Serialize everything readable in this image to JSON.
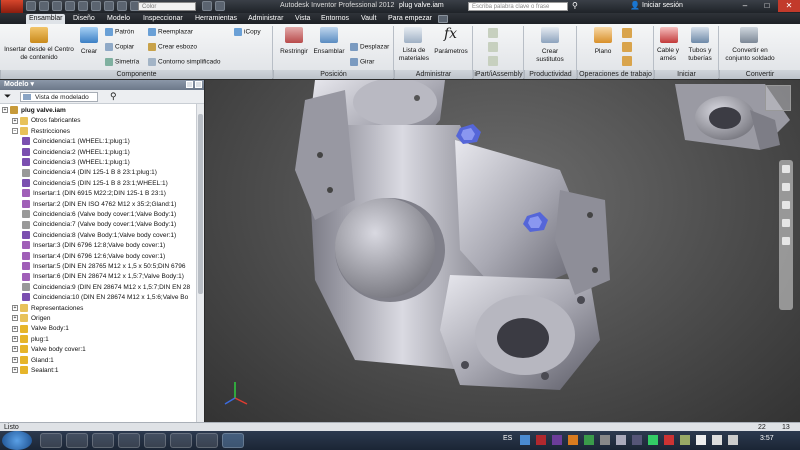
{
  "titlebar": {
    "color_placeholder": "Color",
    "app_title": "Autodesk Inventor Professional 2012",
    "file_name": "plug valve.iam",
    "search_placeholder": "Escriba palabra clave o frase",
    "login": "Iniciar sesión",
    "window_buttons": [
      "–",
      "□",
      "✕"
    ]
  },
  "tabs": [
    "Ensamblar",
    "Diseño",
    "Modelo",
    "Inspeccionar",
    "Herramientas",
    "Administrar",
    "Vista",
    "Entornos",
    "Vault",
    "Para empezar"
  ],
  "ribbon": {
    "componente": {
      "label": "Componente",
      "insert": "Insertar desde el Centro de contenido",
      "crear": "Crear",
      "patron": "Patrón",
      "copiar": "Copiar",
      "simetria": "Simetría",
      "reemplazar": "Reemplazar",
      "crear_esbozo": "Crear esbozo",
      "contorno": "Contorno simplificado",
      "icopy": "iCopy"
    },
    "posicion": {
      "label": "Posición",
      "restringir": "Restringir",
      "ensamblar": "Ensamblar",
      "desplazar": "Desplazar",
      "girar": "Girar"
    },
    "administrar": {
      "label": "Administrar",
      "lista": "Lista de materiales",
      "parametros": "Parámetros"
    },
    "ipart_label": "iPart/iAssembly",
    "productividad": {
      "label": "Productividad",
      "crear_sustitutos": "Crear sustitutos"
    },
    "operaciones": {
      "label": "Operaciones de trabajo",
      "plano": "Plano"
    },
    "iniciar": {
      "label": "Iniciar",
      "cable": "Cable y arnés",
      "tubos": "Tubos y tuberías"
    },
    "convertir": {
      "label": "Convertir",
      "convertir": "Convertir en conjunto soldado"
    }
  },
  "browser": {
    "title": "Modelo ▾",
    "view": "Vista de modelado",
    "tree": [
      {
        "label": "plug valve.iam",
        "level": 0,
        "icon": "assembly-icon",
        "bold": true
      },
      {
        "label": "Otros fabricantes",
        "level": 1,
        "icon": "folder-icon"
      },
      {
        "label": "Restricciones",
        "level": 1,
        "icon": "folder-icon",
        "open": true
      },
      {
        "label": "Coincidencia:1 (WHEEL:1;plug:1)",
        "level": 2,
        "icon": "mate-icon"
      },
      {
        "label": "Coincidencia:2 (WHEEL:1;plug:1)",
        "level": 2,
        "icon": "mate-icon"
      },
      {
        "label": "Coincidencia:3 (WHEEL:1;plug:1)",
        "level": 2,
        "icon": "mate-icon"
      },
      {
        "label": "Coincidencia:4 (DIN 125-1 B 8 23:1;plug:1)",
        "level": 2,
        "icon": "link-icon"
      },
      {
        "label": "Coincidencia:5 (DIN 125-1 B 8 23:1;WHEEL:1)",
        "level": 2,
        "icon": "mate-icon"
      },
      {
        "label": "Insertar:1 (DIN 6915 M22:2;DIN 125-1 B 23:1)",
        "level": 2,
        "icon": "insert-icon"
      },
      {
        "label": "Insertar:2 (DIN EN ISO 4762 M12 x 35:2;Gland:1)",
        "level": 2,
        "icon": "insert-icon"
      },
      {
        "label": "Coincidencia:6 (Valve body cover:1;Valve Body:1)",
        "level": 2,
        "icon": "link-icon"
      },
      {
        "label": "Coincidencia:7 (Valve body cover:1;Valve Body:1)",
        "level": 2,
        "icon": "link-icon"
      },
      {
        "label": "Coincidencia:8 (Valve Body:1;Valve body cover:1)",
        "level": 2,
        "icon": "mate-icon"
      },
      {
        "label": "Insertar:3 (DIN 6796 12:8;Valve body cover:1)",
        "level": 2,
        "icon": "insert-icon"
      },
      {
        "label": "Insertar:4 (DIN 6796 12:6;Valve body cover:1)",
        "level": 2,
        "icon": "insert-icon"
      },
      {
        "label": "Insertar:5 (DIN EN 28765 M12 x 1,5 x 50:5;DIN 6796",
        "level": 2,
        "icon": "insert-icon"
      },
      {
        "label": "Insertar:6 (DIN EN 28674 M12 x 1,5:7;Valve Body:1)",
        "level": 2,
        "icon": "insert-icon"
      },
      {
        "label": "Coincidencia:9 (DIN EN 28674 M12 x 1,5:7;DIN EN 28",
        "level": 2,
        "icon": "link-icon"
      },
      {
        "label": "Coincidencia:10 (DIN EN 28674 M12 x 1,5:6;Valve Bo",
        "level": 2,
        "icon": "mate-icon"
      },
      {
        "label": "Representaciones",
        "level": 1,
        "icon": "folder-icon"
      },
      {
        "label": "Origen",
        "level": 1,
        "icon": "folder-icon"
      },
      {
        "label": "Valve Body:1",
        "level": 1,
        "icon": "part-icon"
      },
      {
        "label": "plug:1",
        "level": 1,
        "icon": "part-icon"
      },
      {
        "label": "Valve body cover:1",
        "level": 1,
        "icon": "part-icon"
      },
      {
        "label": "Gland:1",
        "level": 1,
        "icon": "part-icon"
      },
      {
        "label": "Sealant:1",
        "level": 1,
        "icon": "part-icon"
      }
    ]
  },
  "status": {
    "left": "Listo",
    "right_a": "22",
    "right_b": "13"
  },
  "taskbar": {
    "lang": "ES",
    "clock": "3:57"
  }
}
